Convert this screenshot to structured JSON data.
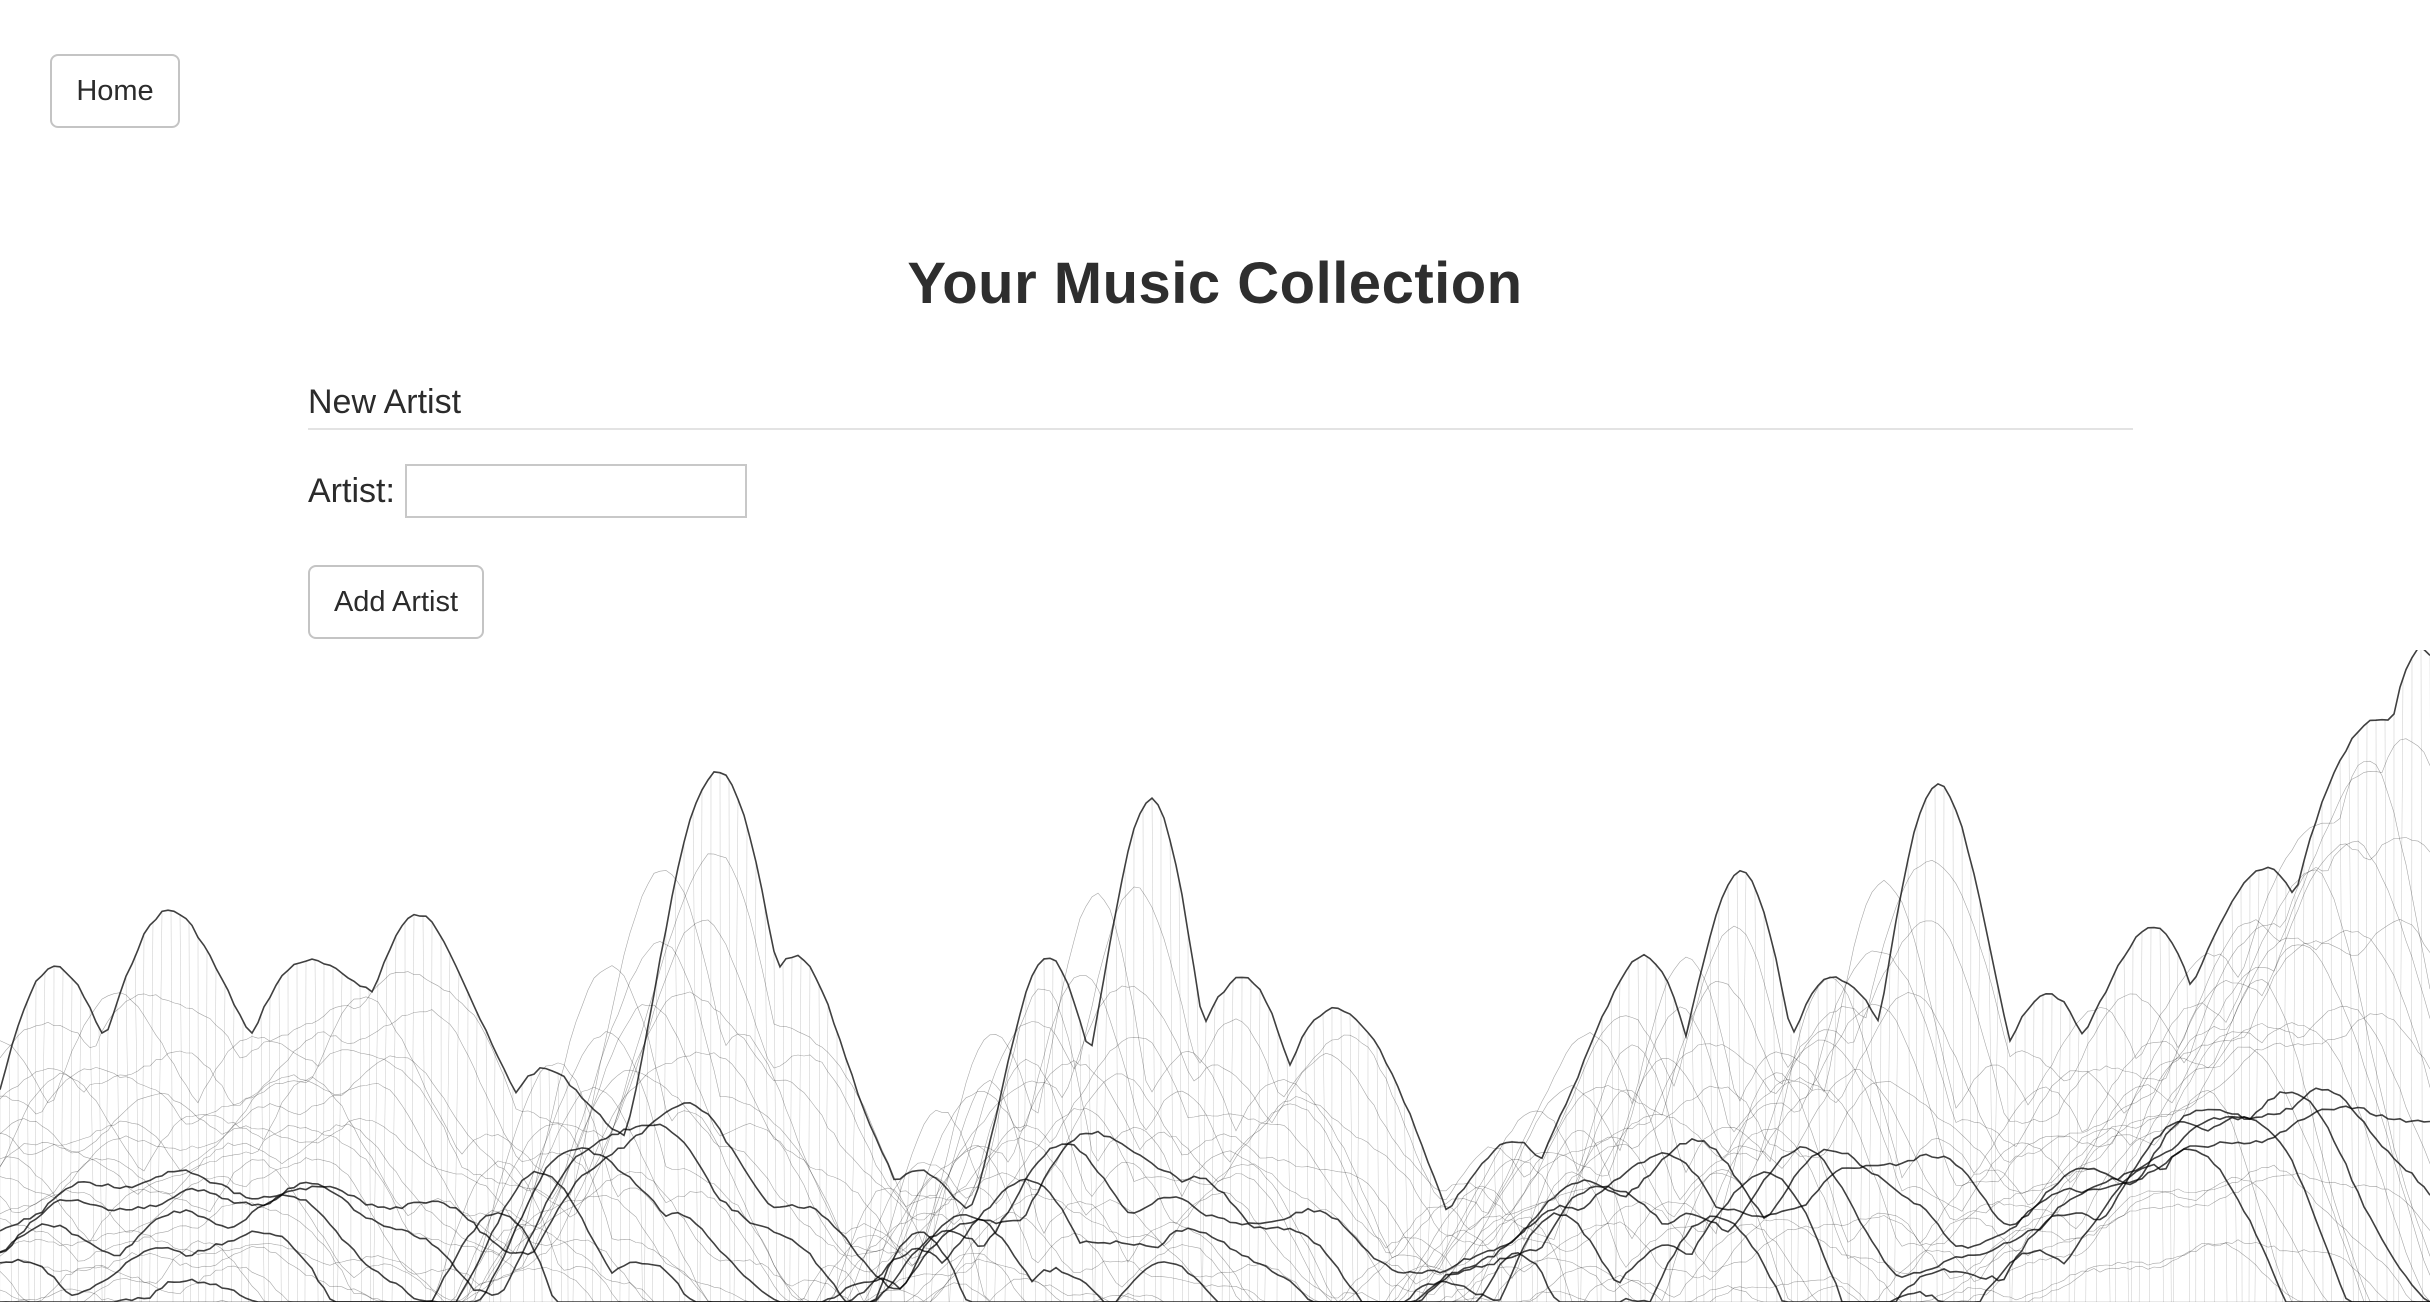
{
  "nav": {
    "home_label": "Home"
  },
  "header": {
    "title": "Your Music Collection"
  },
  "form": {
    "legend": "New Artist",
    "artist_label": "Artist:",
    "artist_value": "",
    "artist_placeholder": "",
    "submit_label": "Add Artist"
  },
  "decoration": {
    "type": "wireframe-mountain-terrain",
    "line_color": "#000000"
  }
}
